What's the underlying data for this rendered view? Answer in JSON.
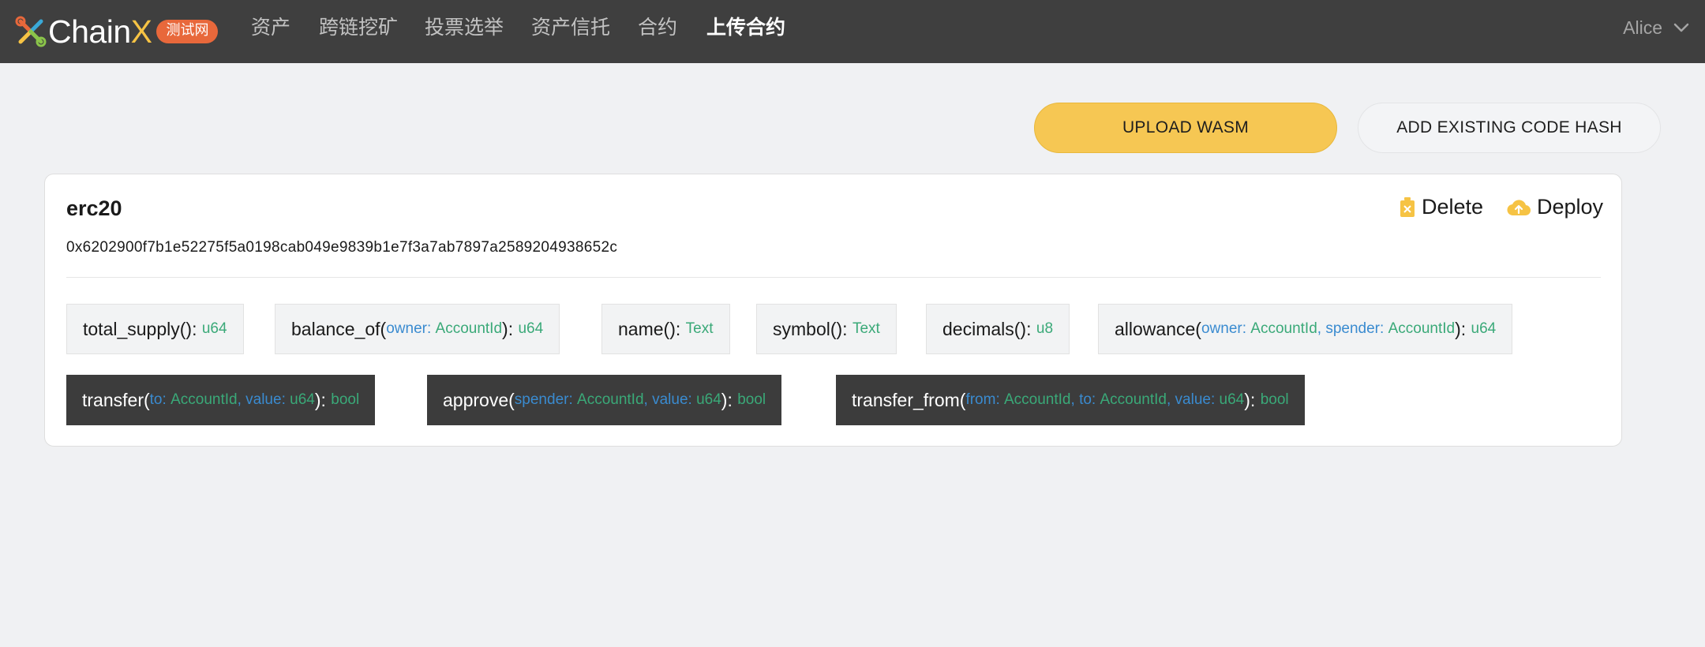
{
  "brand": {
    "name": "Chain",
    "name_suffix": "X",
    "badge": "测试网",
    "colors": {
      "accent": "#f6c344",
      "badge": "#e8683b",
      "header_bg": "#3f3f3f"
    }
  },
  "nav": {
    "items": [
      {
        "label": "资产"
      },
      {
        "label": "跨链挖矿"
      },
      {
        "label": "投票选举"
      },
      {
        "label": "资产信托"
      },
      {
        "label": "合约"
      },
      {
        "label": "上传合约",
        "active": true
      }
    ]
  },
  "account": {
    "name": "Alice",
    "icon": "chevron-down-icon"
  },
  "actions": {
    "upload_wasm": "UPLOAD WASM",
    "add_code_hash": "ADD EXISTING CODE HASH"
  },
  "contract": {
    "name": "erc20",
    "code_hash": "0x6202900f7b1e52275f5a0198cab049e9839b1e7f3a7ab7897a2589204938652c",
    "delete_label": "Delete",
    "deploy_label": "Deploy",
    "methods": [
      {
        "name": "total_supply",
        "params": [],
        "returns": "u64",
        "kind": "read"
      },
      {
        "name": "balance_of",
        "params": [
          {
            "name": "owner",
            "type": "AccountId"
          }
        ],
        "returns": "u64",
        "kind": "read"
      },
      {
        "name": "name",
        "params": [],
        "returns": "Text",
        "kind": "read"
      },
      {
        "name": "symbol",
        "params": [],
        "returns": "Text",
        "kind": "read"
      },
      {
        "name": "decimals",
        "params": [],
        "returns": "u8",
        "kind": "read"
      },
      {
        "name": "allowance",
        "params": [
          {
            "name": "owner",
            "type": "AccountId"
          },
          {
            "name": "spender",
            "type": "AccountId"
          }
        ],
        "returns": "u64",
        "kind": "read"
      },
      {
        "name": "transfer",
        "params": [
          {
            "name": "to",
            "type": "AccountId"
          },
          {
            "name": "value",
            "type": "u64"
          }
        ],
        "returns": "bool",
        "kind": "tx"
      },
      {
        "name": "approve",
        "params": [
          {
            "name": "spender",
            "type": "AccountId"
          },
          {
            "name": "value",
            "type": "u64"
          }
        ],
        "returns": "bool",
        "kind": "tx"
      },
      {
        "name": "transfer_from",
        "params": [
          {
            "name": "from",
            "type": "AccountId"
          },
          {
            "name": "to",
            "type": "AccountId"
          },
          {
            "name": "value",
            "type": "u64"
          }
        ],
        "returns": "bool",
        "kind": "tx"
      }
    ]
  }
}
